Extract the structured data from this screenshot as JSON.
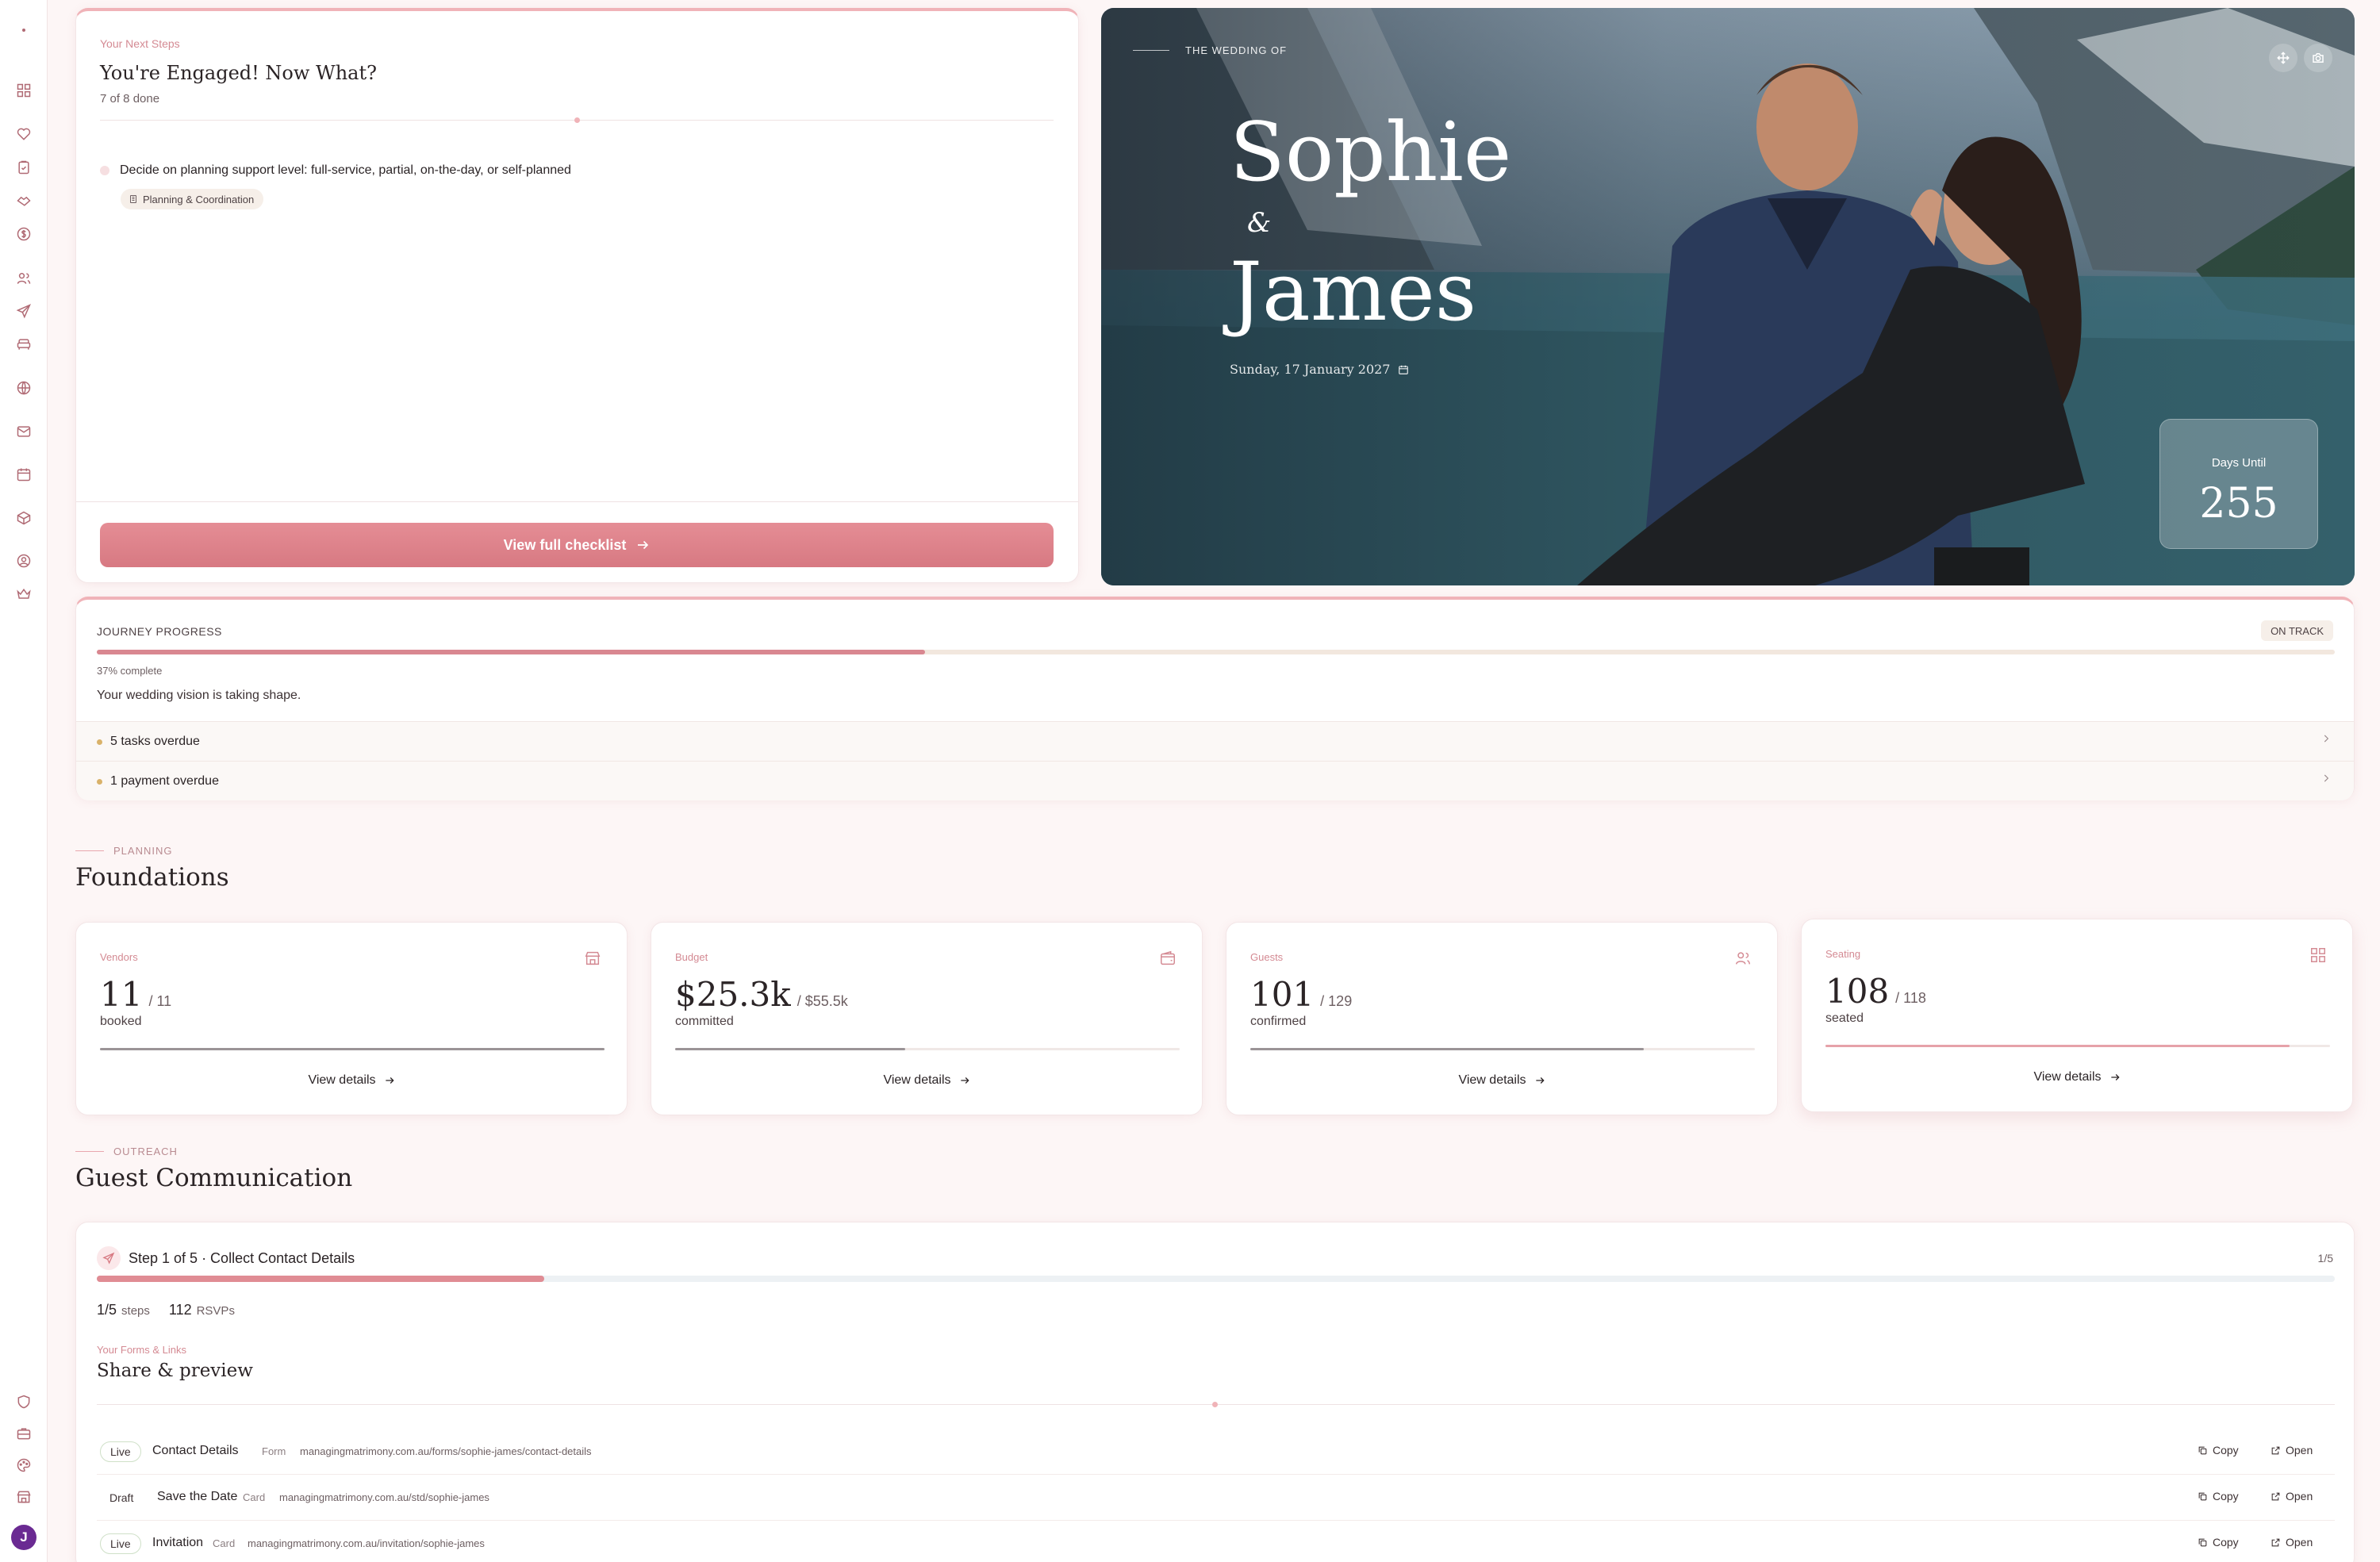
{
  "sidebar": {
    "icons": [
      "dot-icon",
      "dashboard-icon",
      "heart-icon",
      "clipboard-icon",
      "handshake-icon",
      "dollar-icon",
      "users-icon",
      "send-icon",
      "armchair-icon",
      "globe-icon",
      "mail-icon",
      "calendar-icon",
      "package-icon",
      "user-circle-icon",
      "crown-icon",
      "shield-icon",
      "briefcase-icon",
      "palette-icon",
      "store-icon"
    ],
    "avatar_initial": "J"
  },
  "next_steps": {
    "eyebrow": "Your Next Steps",
    "title": "You're Engaged! Now What?",
    "count": "7 of 8 done",
    "task": "Decide on planning support level: full-service, partial, on-the-day, or self-planned",
    "tag": "Planning & Coordination",
    "button": "View full checklist"
  },
  "hero": {
    "eyebrow": "THE WEDDING OF",
    "name1": "Sophie",
    "amp": "&",
    "name2": "James",
    "date": "Sunday, 17 January 2027",
    "days_label": "Days Until",
    "days_value": "255"
  },
  "journey": {
    "label": "JOURNEY PROGRESS",
    "badge": "ON TRACK",
    "progress": 0.37,
    "percent_text": "37% complete",
    "message": "Your wedding vision is taking shape.",
    "alerts": [
      "5 tasks overdue",
      "1 payment overdue"
    ]
  },
  "planning": {
    "eyebrow": "PLANNING",
    "title": "Foundations"
  },
  "stats": [
    {
      "label": "Vendors",
      "value": "11",
      "total": "/ 11",
      "sub": "booked",
      "progress": 1.0,
      "link": "View details",
      "icon": "store-icon"
    },
    {
      "label": "Budget",
      "value": "$25.3k",
      "total": "/ $55.5k",
      "sub": "committed",
      "progress": 0.456,
      "link": "View details",
      "icon": "wallet-icon"
    },
    {
      "label": "Guests",
      "value": "101",
      "total": "/ 129",
      "sub": "confirmed",
      "progress": 0.78,
      "link": "View details",
      "icon": "users-icon"
    },
    {
      "label": "Seating",
      "value": "108",
      "total": "/ 118",
      "sub": "seated",
      "progress": 0.92,
      "link": "View details",
      "icon": "grid-icon"
    }
  ],
  "outreach": {
    "eyebrow": "OUTREACH",
    "title": "Guest Communication"
  },
  "guest": {
    "step_title": "Step 1 of 5 · Collect Contact Details",
    "step_count": "1/5",
    "progress": 0.2,
    "steps_num": "1/5",
    "steps_label": "steps",
    "rsvps_num": "112",
    "rsvps_label": "RSVPs",
    "forms_eyebrow": "Your Forms & Links",
    "forms_title": "Share & preview",
    "copy_label": "Copy",
    "open_label": "Open",
    "links": [
      {
        "status": "Live",
        "name": "Contact Details",
        "type": "Form",
        "url": "managingmatrimony.com.au/forms/sophie-james/contact-details"
      },
      {
        "status": "Draft",
        "name": "Save the Date",
        "type": "Card",
        "url": "managingmatrimony.com.au/std/sophie-james"
      },
      {
        "status": "Live",
        "name": "Invitation",
        "type": "Card",
        "url": "managingmatrimony.com.au/invitation/sophie-james"
      }
    ]
  },
  "colors": {
    "accent": "#d77982",
    "accent_light": "#f0b3b8",
    "background": "#fdf6f6",
    "live_border": "#cfe0c8"
  }
}
